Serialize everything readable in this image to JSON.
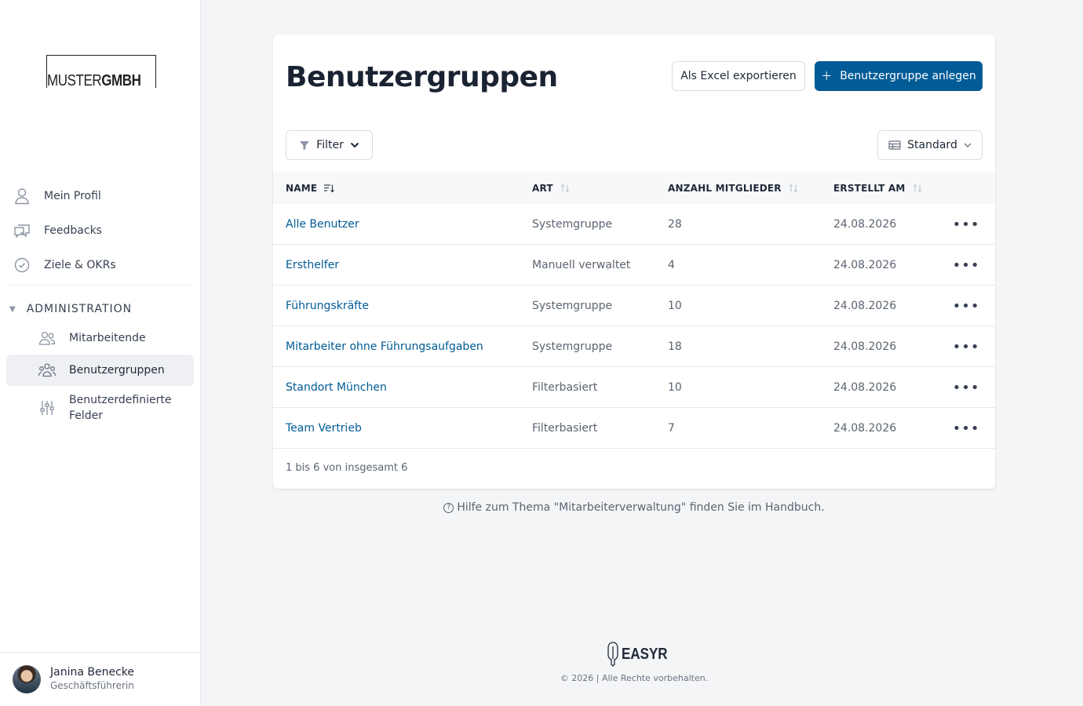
{
  "brand": {
    "logo_thin": "MUSTER",
    "logo_bold": "GMBH"
  },
  "sidebar": {
    "items": [
      {
        "label": "Mein Profil",
        "icon": "user-icon"
      },
      {
        "label": "Feedbacks",
        "icon": "chat-icon"
      },
      {
        "label": "Ziele & OKRs",
        "icon": "check-circle-icon"
      }
    ],
    "section_label": "ADMINISTRATION",
    "sub_items": [
      {
        "label": "Mitarbeitende",
        "icon": "users-icon"
      },
      {
        "label": "Benutzergruppen",
        "icon": "user-group-icon",
        "active": true
      },
      {
        "label": "Benutzerdefinierte Felder",
        "icon": "sliders-icon"
      }
    ],
    "user": {
      "name": "Janina Benecke",
      "role": "Geschäftsführerin"
    }
  },
  "page": {
    "title": "Benutzergruppen",
    "export_label": "Als Excel exportieren",
    "create_label": "Benutzergruppe anlegen",
    "filter_label": "Filter",
    "view_label": "Standard"
  },
  "table": {
    "columns": [
      "NAME",
      "ART",
      "ANZAHL MITGLIEDER",
      "ERSTELLT AM"
    ],
    "rows": [
      {
        "name": "Alle Benutzer",
        "type": "Systemgruppe",
        "members": "28",
        "created": "24.08.2026"
      },
      {
        "name": "Ersthelfer",
        "type": "Manuell verwaltet",
        "members": "4",
        "created": "24.08.2026"
      },
      {
        "name": "Führungskräfte",
        "type": "Systemgruppe",
        "members": "10",
        "created": "24.08.2026"
      },
      {
        "name": "Mitarbeiter ohne Führungsaufgaben",
        "type": "Systemgruppe",
        "members": "18",
        "created": "24.08.2026"
      },
      {
        "name": "Standort München",
        "type": "Filterbasiert",
        "members": "10",
        "created": "24.08.2026"
      },
      {
        "name": "Team Vertrieb",
        "type": "Filterbasiert",
        "members": "7",
        "created": "24.08.2026"
      }
    ],
    "row_menu_label": "•••",
    "pagination": "1 bis 6 von insgesamt 6"
  },
  "help_text": "Hilfe zum Thema \"Mitarbeiterverwaltung\" finden Sie im Handbuch.",
  "footer": {
    "brand": "EASYR",
    "copyright": "© 2026 | Alle Rechte vorbehalten."
  },
  "colors": {
    "primary": "#005b96",
    "link": "#005b96",
    "background": "#f4f5f7"
  }
}
